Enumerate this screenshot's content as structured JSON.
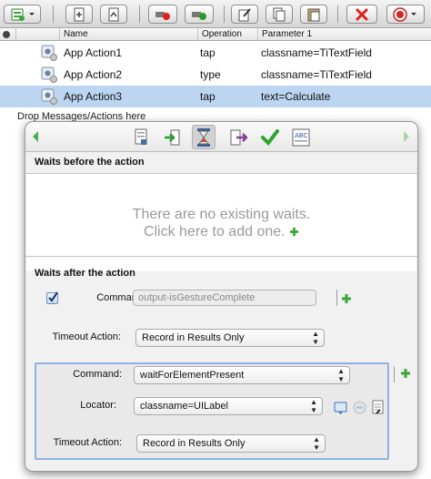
{
  "toolbar": {
    "buttons": [
      {
        "icon": "add-action-icon"
      },
      {
        "icon": "import-icon"
      },
      {
        "icon": "import-alt-icon"
      },
      {
        "icon": "record-stop-icon"
      },
      {
        "icon": "record-start-icon"
      },
      {
        "icon": "edit-document-icon"
      },
      {
        "icon": "copy-icon"
      },
      {
        "icon": "paste-icon"
      },
      {
        "icon": "delete-icon"
      },
      {
        "icon": "record-menu-icon"
      }
    ]
  },
  "table": {
    "columns": [
      "Name",
      "Operation",
      "Parameter 1"
    ],
    "rows": [
      {
        "name": "App Action1",
        "operation": "tap",
        "param1": "classname=TiTextField"
      },
      {
        "name": "App Action2",
        "operation": "type",
        "param1": "classname=TiTextField"
      },
      {
        "name": "App Action3",
        "operation": "tap",
        "param1": "text=Calculate"
      }
    ],
    "drop_hint": "Drop Messages/Actions here"
  },
  "popover": {
    "tabs": [
      "document-icon",
      "step-in-icon",
      "hourglass-icon",
      "step-out-icon",
      "checkmark-icon",
      "abc-validation-icon"
    ],
    "waits_before_title": "Waits before the action",
    "no_waits_line1": "There are no existing waits.",
    "no_waits_line2": "Click here to add one.",
    "waits_after_title": "Waits after the action",
    "wait1": {
      "command_label": "Command:",
      "command_value": "output-isGestureComplete",
      "timeout_label": "Timeout Action:",
      "timeout_value": "Record in Results Only",
      "checked": true
    },
    "wait2": {
      "command_label": "Command:",
      "command_value": "waitForElementPresent",
      "locator_label": "Locator:",
      "locator_value": "classname=UILabel",
      "timeout_label": "Timeout Action:",
      "timeout_value": "Record in Results Only"
    }
  },
  "colors": {
    "selection": "#bcd6f2",
    "add_green": "#3aa63a",
    "group_border": "#8eb2e0",
    "delete_red": "#e0201c"
  }
}
